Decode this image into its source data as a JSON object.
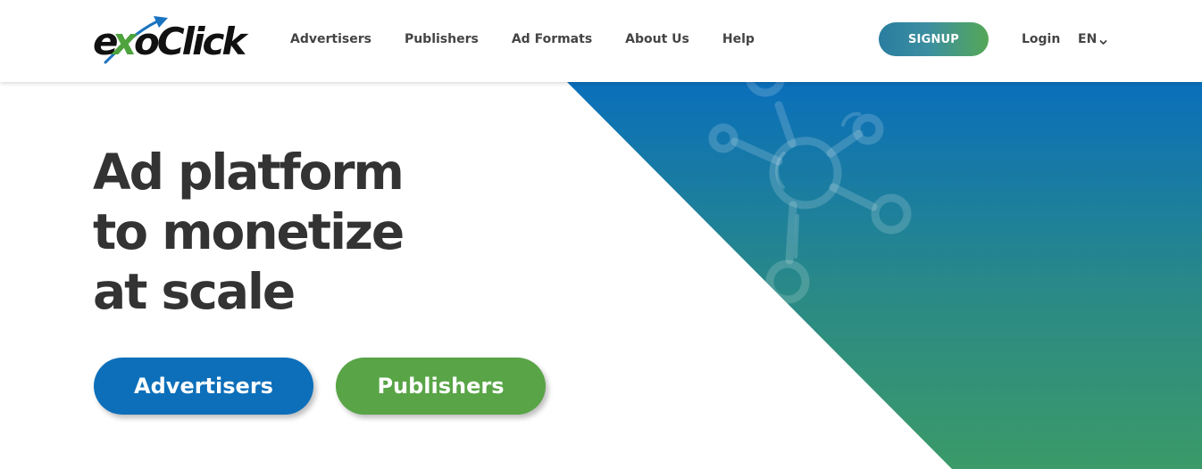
{
  "brand": {
    "name": "exoClick",
    "colors": {
      "blue": "#0d6fba",
      "green": "#58a446",
      "dark_text": "#333333"
    }
  },
  "nav": {
    "items": [
      {
        "label": "Advertisers"
      },
      {
        "label": "Publishers"
      },
      {
        "label": "Ad Formats"
      },
      {
        "label": "About Us"
      },
      {
        "label": "Help"
      }
    ],
    "signup_label": "SIGNUP",
    "login_label": "Login",
    "language": {
      "selected": "EN",
      "icon": "chevron-down-icon"
    }
  },
  "hero": {
    "title_lines": [
      "Ad platform",
      "to monetize",
      "at scale"
    ],
    "buttons": {
      "advertisers_label": "Advertisers",
      "publishers_label": "Publishers"
    },
    "background_graphic": "network-nodes-icon",
    "gradient_colors": [
      "#0a6fbb",
      "#2f8f7a",
      "#3b9a68"
    ]
  }
}
